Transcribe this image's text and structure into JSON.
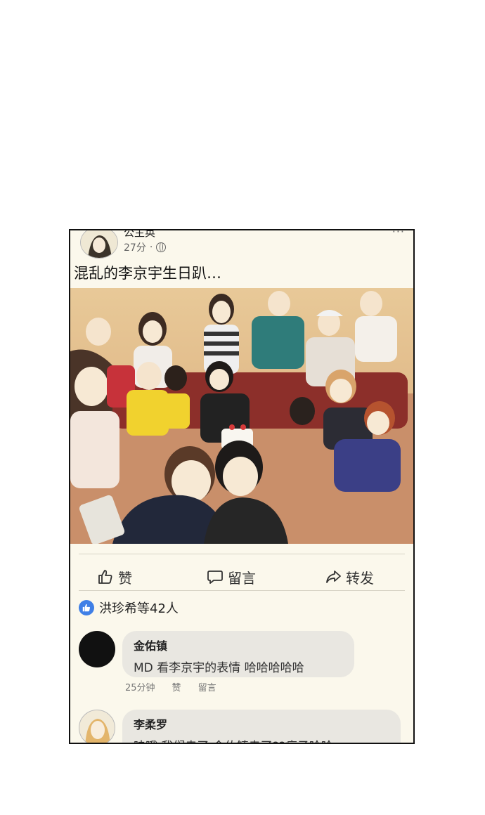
{
  "post": {
    "author": "公主奂",
    "time": "27分",
    "separator": "·",
    "more": "···",
    "text": "混乱的李京宇生日趴…"
  },
  "actions": {
    "like": "赞",
    "comment": "留言",
    "share": "转发"
  },
  "reactions": {
    "summary": "洪珍希等42人"
  },
  "comments": [
    {
      "name": "金佑镇",
      "text": "MD 看李京宇的表情 哈哈哈哈哈",
      "time": "25分钟",
      "like": "赞",
      "reply": "留言"
    },
    {
      "name": "李柔罗",
      "text": "哇哦 我们走了 金佑镇走了??疯子哈哈"
    }
  ],
  "colors": {
    "panel_bg": "#fbf8ec",
    "like_badge": "#3f7fe6",
    "bubble": "#e9e7e1"
  }
}
